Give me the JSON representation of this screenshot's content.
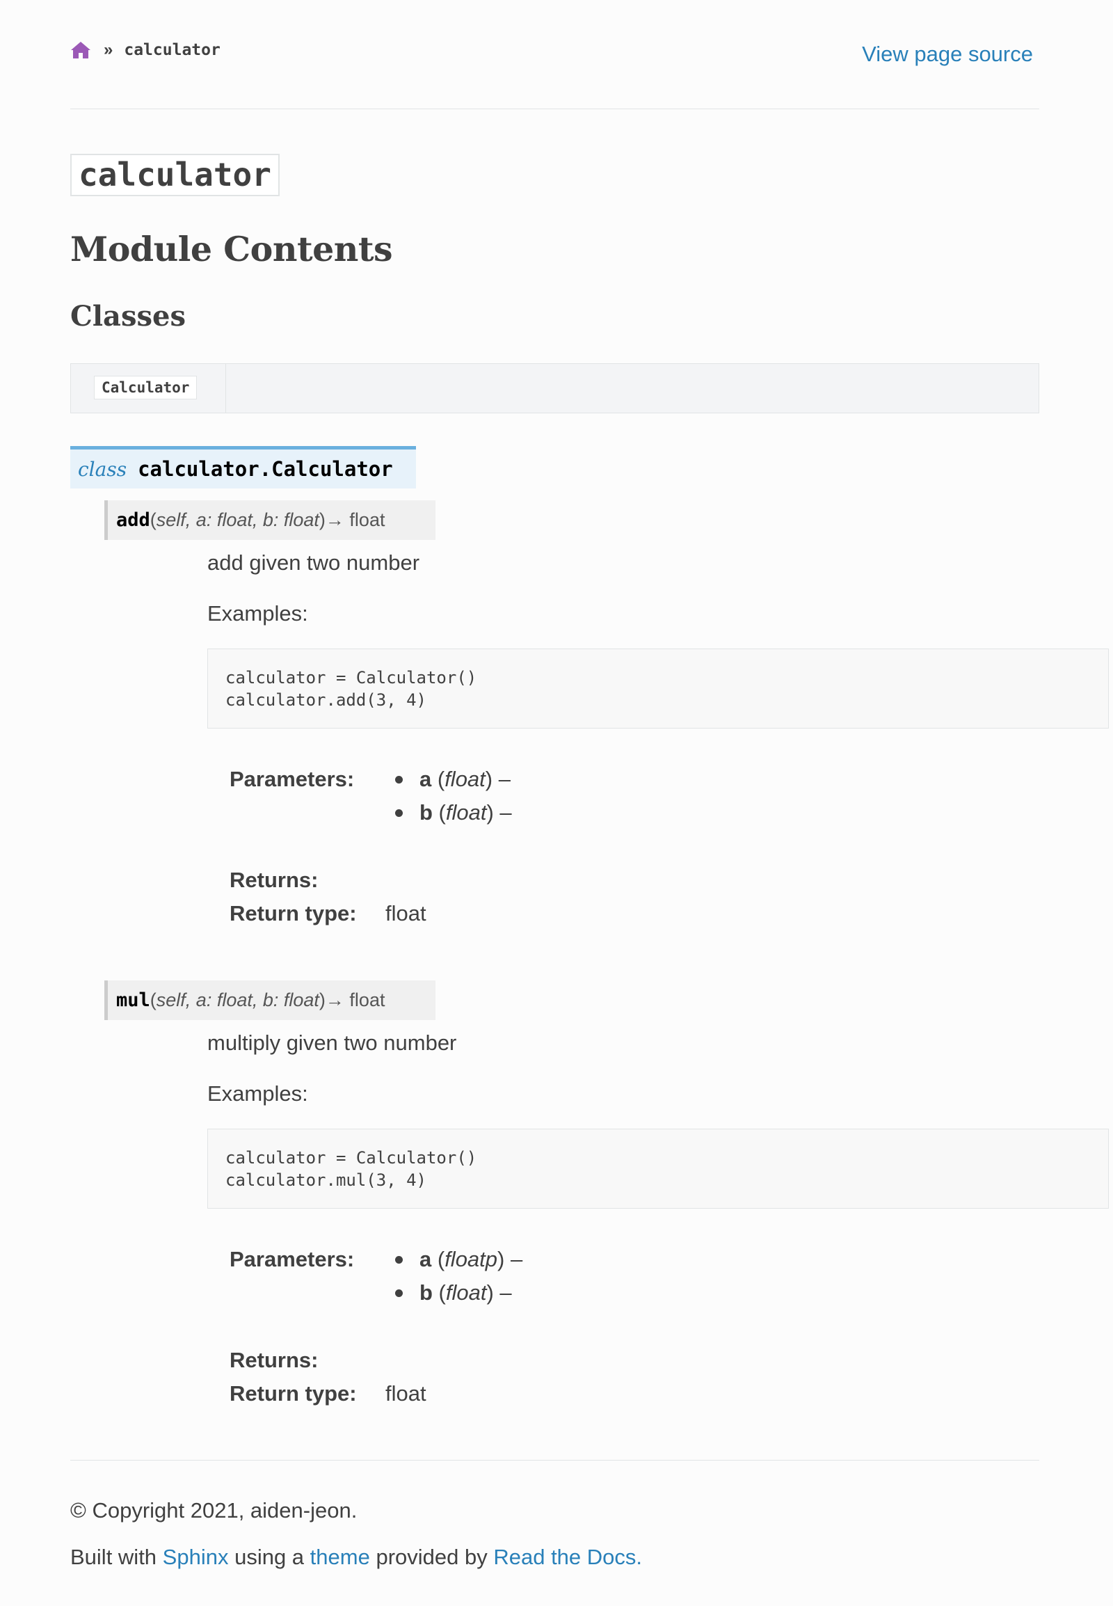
{
  "breadcrumb": {
    "home_icon": "home-icon",
    "separator": "»",
    "current": "calculator",
    "view_source": "View page source"
  },
  "module": {
    "title": "calculator",
    "h2": "Module Contents",
    "h3": "Classes",
    "summary_class": "Calculator"
  },
  "class_sig": {
    "keyword": "class",
    "name": "calculator.Calculator"
  },
  "methods": [
    {
      "name": "add",
      "params_open": "(",
      "params": "self, a: float, b: float",
      "params_close": ")",
      "returns": " → float",
      "description": "add given two number",
      "examples_label": "Examples:",
      "code": "calculator = Calculator()\ncalculator.add(3, 4)",
      "parameters_label": "Parameters:",
      "parameters": [
        {
          "name": "a",
          "type": "float"
        },
        {
          "name": "b",
          "type": "float"
        }
      ],
      "returns_label": "Returns:",
      "return_type_label": "Return type:",
      "return_type": "float"
    },
    {
      "name": "mul",
      "params_open": "(",
      "params": "self, a: float, b: float",
      "params_close": ")",
      "returns": " → float",
      "description": "multiply given two number",
      "examples_label": "Examples:",
      "code": "calculator = Calculator()\ncalculator.mul(3, 4)",
      "parameters_label": "Parameters:",
      "parameters": [
        {
          "name": "a",
          "type": "floatp"
        },
        {
          "name": "b",
          "type": "float"
        }
      ],
      "returns_label": "Returns:",
      "return_type_label": "Return type:",
      "return_type": "float"
    }
  ],
  "footer": {
    "copyright": "© Copyright 2021, aiden-jeon.",
    "built_with": "Built with ",
    "sphinx": "Sphinx",
    "using_a": " using a ",
    "theme": "theme",
    "provided_by": " provided by ",
    "rtd": "Read the Docs",
    "period": "."
  },
  "colors": {
    "link": "#2980b9",
    "home_icon": "#9b59b6",
    "class_bg": "#e7f2fa",
    "class_border": "#6ab0de"
  }
}
